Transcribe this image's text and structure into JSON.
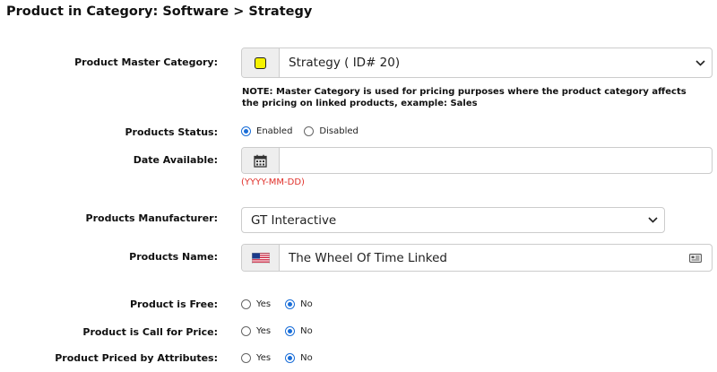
{
  "page": {
    "title": "Product in Category: Software > Strategy"
  },
  "master_category": {
    "label": "Product Master Category:",
    "value": "Strategy ( ID# 20)",
    "note": "NOTE: Master Category is used for pricing purposes where the product category affects the pricing on linked products, example: Sales",
    "swatch_color": "#f5f200"
  },
  "status": {
    "label": "Products Status:",
    "options": [
      "Enabled",
      "Disabled"
    ],
    "selected": "Enabled"
  },
  "date_available": {
    "label": "Date Available:",
    "value": "",
    "hint": "(YYYY-MM-DD)"
  },
  "manufacturer": {
    "label": "Products Manufacturer:",
    "value": "GT Interactive"
  },
  "name": {
    "label": "Products Name:",
    "value": "The Wheel Of Time Linked"
  },
  "free": {
    "label": "Product is Free:",
    "options": [
      "Yes",
      "No"
    ],
    "selected": "No"
  },
  "call_for_price": {
    "label": "Product is Call for Price:",
    "options": [
      "Yes",
      "No"
    ],
    "selected": "No"
  },
  "priced_by_attributes": {
    "label": "Product Priced by Attributes:",
    "options": [
      "Yes",
      "No"
    ],
    "selected": "No"
  },
  "colors": {
    "accent": "#1a6ed8",
    "hint": "#e0312b",
    "addon_bg": "#eeeeee"
  },
  "icons": [
    "yellow-swatch-icon",
    "chevron-down-icon",
    "calendar-icon",
    "us-flag-icon",
    "card-icon"
  ]
}
